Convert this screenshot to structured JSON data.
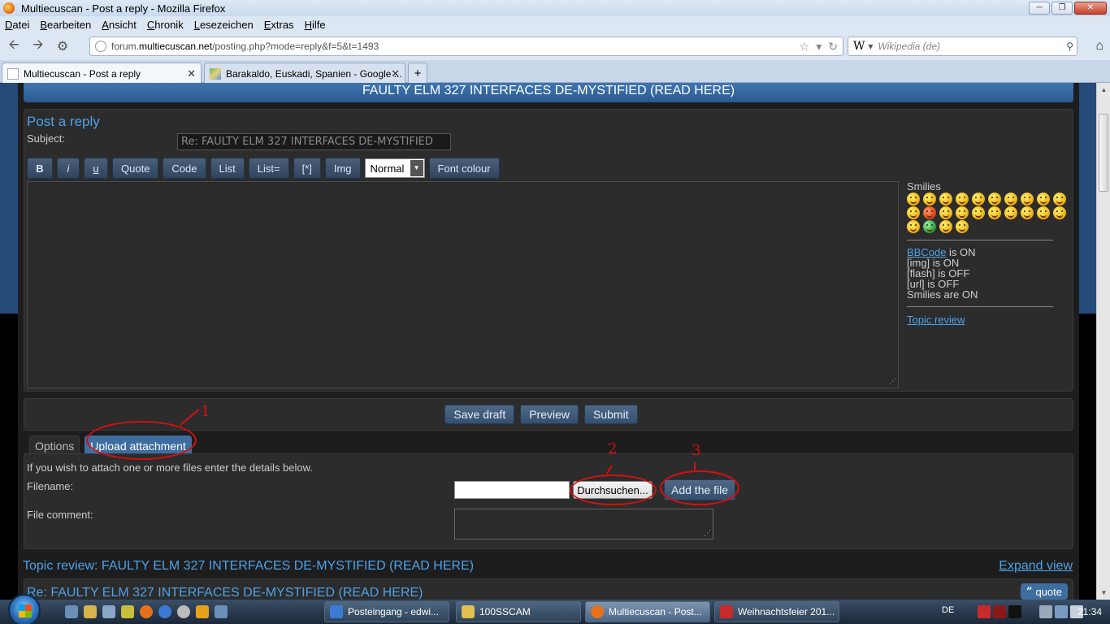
{
  "window": {
    "title": "Multiecuscan - Post a reply - Mozilla Firefox"
  },
  "menu": [
    "Datei",
    "Bearbeiten",
    "Ansicht",
    "Chronik",
    "Lesezeichen",
    "Extras",
    "Hilfe"
  ],
  "nav": {
    "url_prefix": "forum.",
    "url_host": "multiecuscan.net",
    "url_path": "/posting.php?mode=reply&f=5&t=1493",
    "search_placeholder": "Wikipedia (de)",
    "search_engine_glyph": "W"
  },
  "tabs": [
    {
      "label": "Multiecuscan - Post a reply",
      "active": true
    },
    {
      "label": "Barakaldo, Euskadi, Spanien - Google ...",
      "active": false
    }
  ],
  "page": {
    "topic_banner": "FAULTY ELM 327 INTERFACES DE-MYSTIFIED (READ HERE)",
    "heading": "Post a reply",
    "subject_label": "Subject:",
    "subject_value": "Re: FAULTY ELM 327 INTERFACES DE-MYSTIFIED",
    "toolbar": {
      "bold": "B",
      "italic": "i",
      "underline": "u",
      "quote": "Quote",
      "code": "Code",
      "list": "List",
      "list_eq": "List=",
      "list_item": "[*]",
      "img": "Img",
      "font_size": "Normal",
      "font_colour": "Font colour"
    },
    "smilies_title": "Smilies",
    "bbcode_link": "BBCode",
    "bbcode_status": " is ON",
    "img_status": "[img] is ON",
    "flash_status": "[flash] is OFF",
    "url_status": "[url] is OFF",
    "smilies_status": "Smilies are ON",
    "topic_review_link": "Topic review",
    "actions": {
      "save_draft": "Save draft",
      "preview": "Preview",
      "submit": "Submit"
    },
    "panel_tabs": {
      "options": "Options",
      "upload": "Upload attachment"
    },
    "attach_intro": "If you wish to attach one or more files enter the details below.",
    "filename_label": "Filename:",
    "browse_label": "Durchsuchen...",
    "add_file_label": "Add the file",
    "comment_label": "File comment:",
    "review_title": "Topic review: FAULTY ELM 327 INTERFACES DE-MYSTIFIED (READ HERE)",
    "expand_view": "Expand view",
    "review_post_title": "Re: FAULTY ELM 327 INTERFACES DE-MYSTIFIED (READ HERE)",
    "quote_button": "quote",
    "quote_glyph": "”"
  },
  "annotations": [
    "1",
    "2",
    "3"
  ],
  "taskbar": {
    "tasks": [
      {
        "label": "Posteingang - edwi...",
        "color": "#3b7bd6"
      },
      {
        "label": "100SSCAM",
        "color": "#e0c050"
      },
      {
        "label": "Multiecuscan - Post...",
        "color": "#e8701a",
        "active": true
      },
      {
        "label": "Weihnachtsfeier 201...",
        "color": "#c62a2a"
      }
    ],
    "language": "DE",
    "clock": "21:34"
  }
}
